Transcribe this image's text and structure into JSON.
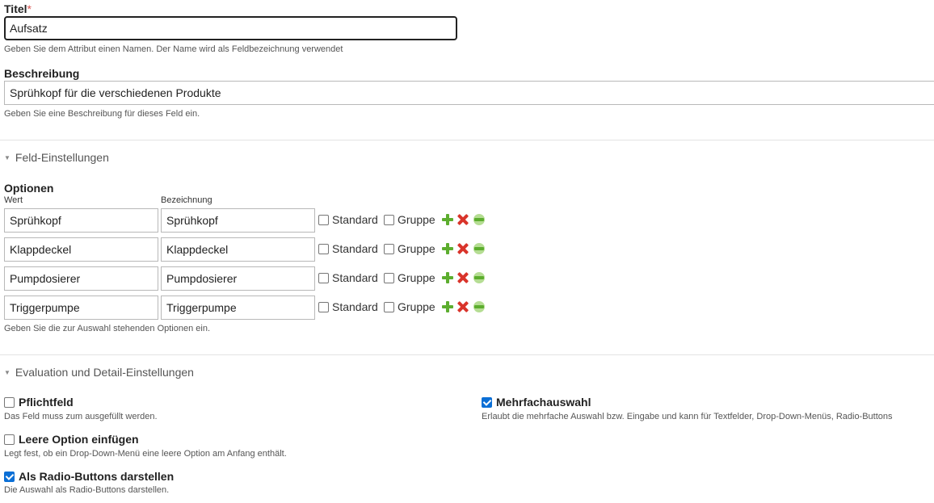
{
  "title_field": {
    "label": "Titel",
    "required_mark": "*",
    "value": "Aufsatz",
    "help": "Geben Sie dem Attribut einen Namen. Der Name wird als Feldbezeichnung verwendet"
  },
  "description_field": {
    "label": "Beschreibung",
    "value": "Sprühkopf für die verschiedenen Produkte",
    "help": "Geben Sie eine Beschreibung für dieses Feld ein."
  },
  "field_settings": {
    "section_label": "Feld-Einstellungen",
    "options_label": "Optionen",
    "col_value": "Wert",
    "col_label": "Bezeichnung",
    "standard_label": "Standard",
    "group_label": "Gruppe",
    "options": [
      {
        "value": "Sprühkopf",
        "label": "Sprühkopf",
        "standard": false,
        "group": false
      },
      {
        "value": "Klappdeckel",
        "label": "Klappdeckel",
        "standard": false,
        "group": false
      },
      {
        "value": "Pumpdosierer",
        "label": "Pumpdosierer",
        "standard": false,
        "group": false
      },
      {
        "value": "Triggerpumpe",
        "label": "Triggerpumpe",
        "standard": false,
        "group": false
      }
    ],
    "help": "Geben Sie die zur Auswahl stehenden Optionen ein."
  },
  "evaluation_settings": {
    "section_label": "Evaluation und Detail-Einstellungen",
    "required": {
      "label": "Pflichtfeld",
      "checked": false,
      "help": "Das Feld muss zum ausgefüllt werden."
    },
    "multi": {
      "label": "Mehrfachauswahl",
      "checked": true,
      "help": "Erlaubt die mehrfache Auswahl bzw. Eingabe und kann für Textfelder, Drop-Down-Menüs, Radio-Buttons"
    },
    "empty_option": {
      "label": "Leere Option einfügen",
      "checked": false,
      "help": "Legt fest, ob ein Drop-Down-Menü eine leere Option am Anfang enthält."
    },
    "radio": {
      "label": "Als Radio-Buttons darstellen",
      "checked": true,
      "help": "Die Auswahl als Radio-Buttons darstellen."
    }
  }
}
